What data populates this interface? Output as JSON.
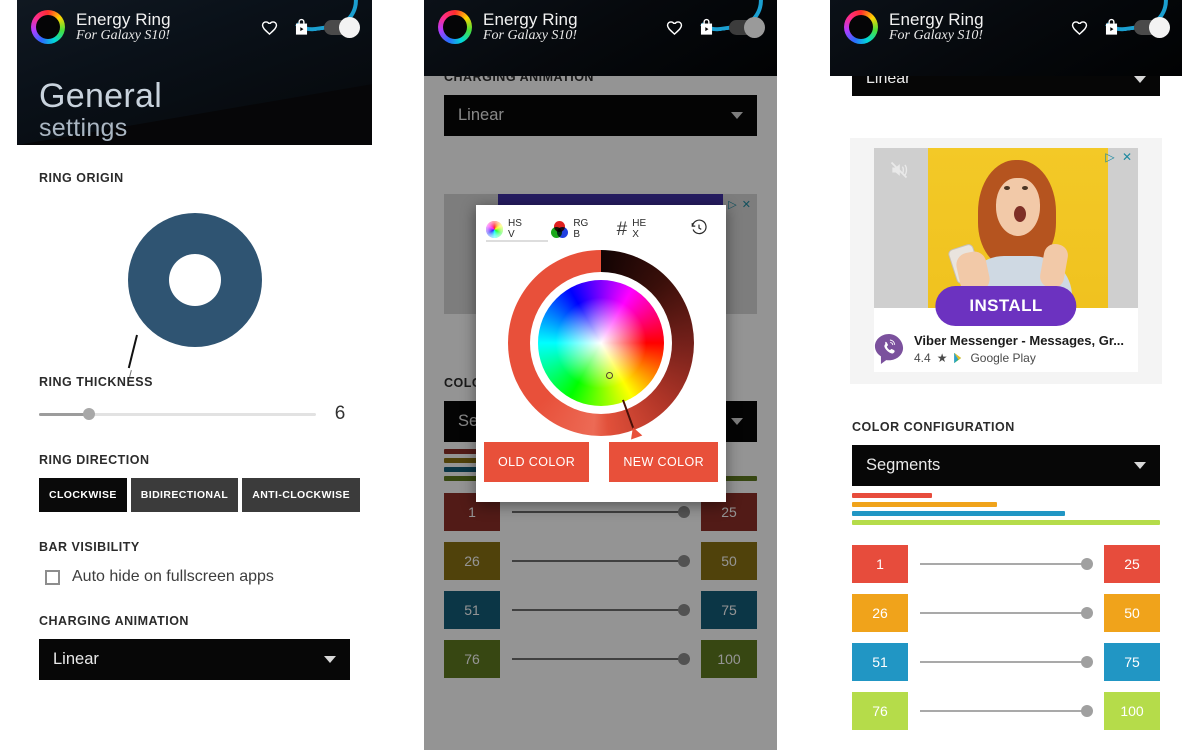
{
  "app": {
    "brand_title": "Energy Ring",
    "brand_subtitle": "For Galaxy S10!",
    "icons": {
      "favorite": "heart-icon",
      "store": "play-store-bag-icon",
      "power": "power-toggle"
    },
    "page_title": "General",
    "page_title_line2": "settings"
  },
  "panel1": {
    "ring_origin": {
      "label": "RING ORIGIN",
      "ring_color": "#2f5472",
      "origin_angle_deg": 194
    },
    "ring_thickness": {
      "label": "RING THICKNESS",
      "value": "6",
      "percent": 18
    },
    "ring_direction": {
      "label": "RING DIRECTION",
      "options": [
        {
          "label": "CLOCKWISE",
          "selected": true
        },
        {
          "label": "BIDIRECTIONAL",
          "selected": false
        },
        {
          "label": "ANTI-CLOCKWISE",
          "selected": false
        }
      ]
    },
    "bar_visibility": {
      "label": "BAR VISIBILITY",
      "checkbox_label": "Auto hide on fullscreen apps",
      "checked": false
    },
    "charging_animation": {
      "label": "CHARGING ANIMATION",
      "value": "Linear"
    }
  },
  "panel2": {
    "charging_animation": {
      "label": "CHARGING ANIMATION",
      "value": "Linear"
    },
    "ad_badge": "▷ ✕",
    "color_configuration": {
      "label": "COLO",
      "value": "Se"
    },
    "bars": [
      {
        "color": "#8e2f28",
        "width_pct": 26
      },
      {
        "color": "#8a7213",
        "width_pct": 47
      },
      {
        "color": "#145d79",
        "width_pct": 69
      },
      {
        "color": "#5f7a1f",
        "width_pct": 100
      }
    ],
    "segments": [
      {
        "from": "1",
        "to": "25",
        "color": "#8e2f28"
      },
      {
        "from": "26",
        "to": "50",
        "color": "#8a7213"
      },
      {
        "from": "51",
        "to": "75",
        "color": "#145d79"
      },
      {
        "from": "76",
        "to": "100",
        "color": "#5f7a1f"
      }
    ],
    "color_picker": {
      "tabs": [
        {
          "label_line1": "HS",
          "label_line2": "V",
          "icon": "hsv-wheel-icon",
          "active": true
        },
        {
          "label_line1": "RG",
          "label_line2": "B",
          "icon": "rgb-circles-icon",
          "active": false
        },
        {
          "label_line1": "HE",
          "label_line2": "X",
          "icon": "hash-icon",
          "active": false
        }
      ],
      "history_icon": "history-clock-icon",
      "old_button": "OLD COLOR",
      "new_button": "NEW COLOR",
      "selected_color": "#e8503a"
    }
  },
  "panel3": {
    "charging_animation_value": "Linear",
    "ad": {
      "badge": "▷ ✕",
      "install_label": "INSTALL",
      "title": "Viber Messenger - Messages, Gr...",
      "rating": "4.4",
      "star": "★",
      "store": "Google Play",
      "mute_icon": "mute-icon"
    },
    "color_configuration": {
      "label": "COLOR CONFIGURATION",
      "value": "Segments"
    },
    "bars": [
      {
        "color": "#e74c3c",
        "width_pct": 26
      },
      {
        "color": "#f0a31b",
        "width_pct": 47
      },
      {
        "color": "#2196c4",
        "width_pct": 69
      },
      {
        "color": "#b5dc4a",
        "width_pct": 100
      }
    ],
    "segments": [
      {
        "from": "1",
        "to": "25",
        "color": "#e74c3c"
      },
      {
        "from": "26",
        "to": "50",
        "color": "#f0a31b"
      },
      {
        "from": "51",
        "to": "75",
        "color": "#2196c4"
      },
      {
        "from": "76",
        "to": "100",
        "color": "#b5dc4a"
      }
    ]
  }
}
